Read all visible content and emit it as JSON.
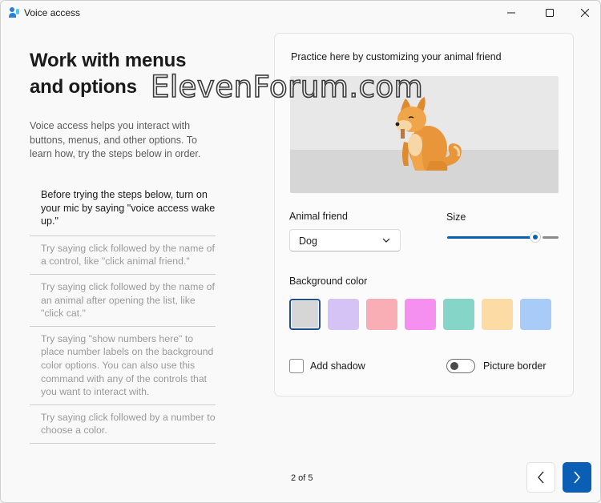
{
  "window": {
    "title": "Voice access",
    "icon": "voice-access-icon",
    "controls": [
      "minimize-icon",
      "maximize-icon",
      "close-icon"
    ]
  },
  "left": {
    "heading_line1": "Work with menus",
    "heading_line2": "and options",
    "description": "Voice access helps you interact with buttons, menus, and other options. To learn how, try the steps below in order."
  },
  "steps": [
    "Before trying the steps below, turn on your mic by saying \"voice access wake up.\"",
    "Try saying click followed by the name of a control, like \"click animal friend.\"",
    "Try saying click followed by the name of an animal after opening the list, like \"click cat.\"",
    "Try saying \"show numbers here\" to place number labels on the background color options. You can also use this command with any of the controls that you want to interact with.",
    "Try saying click followed by a number to choose a color."
  ],
  "watermark": "ElevenForum.com",
  "practice": {
    "title": "Practice here by customizing your animal friend",
    "animal_label": "Animal friend",
    "animal_value": "Dog",
    "size_label": "Size",
    "size_fraction": 0.79,
    "bg_color_label": "Background color",
    "swatch_colors": [
      "#d6d6d6",
      "#d5c3f6",
      "#f8aeb4",
      "#f58ff0",
      "#85d5c8",
      "#fcdba4",
      "#a9cbf8"
    ],
    "selected_swatch": 0,
    "shadow_label": "Add shadow",
    "shadow_checked": false,
    "border_label": "Picture border",
    "border_on": false
  },
  "pager": {
    "text": "2 of 5"
  },
  "colors": {
    "accent": "#0a5fb4"
  }
}
